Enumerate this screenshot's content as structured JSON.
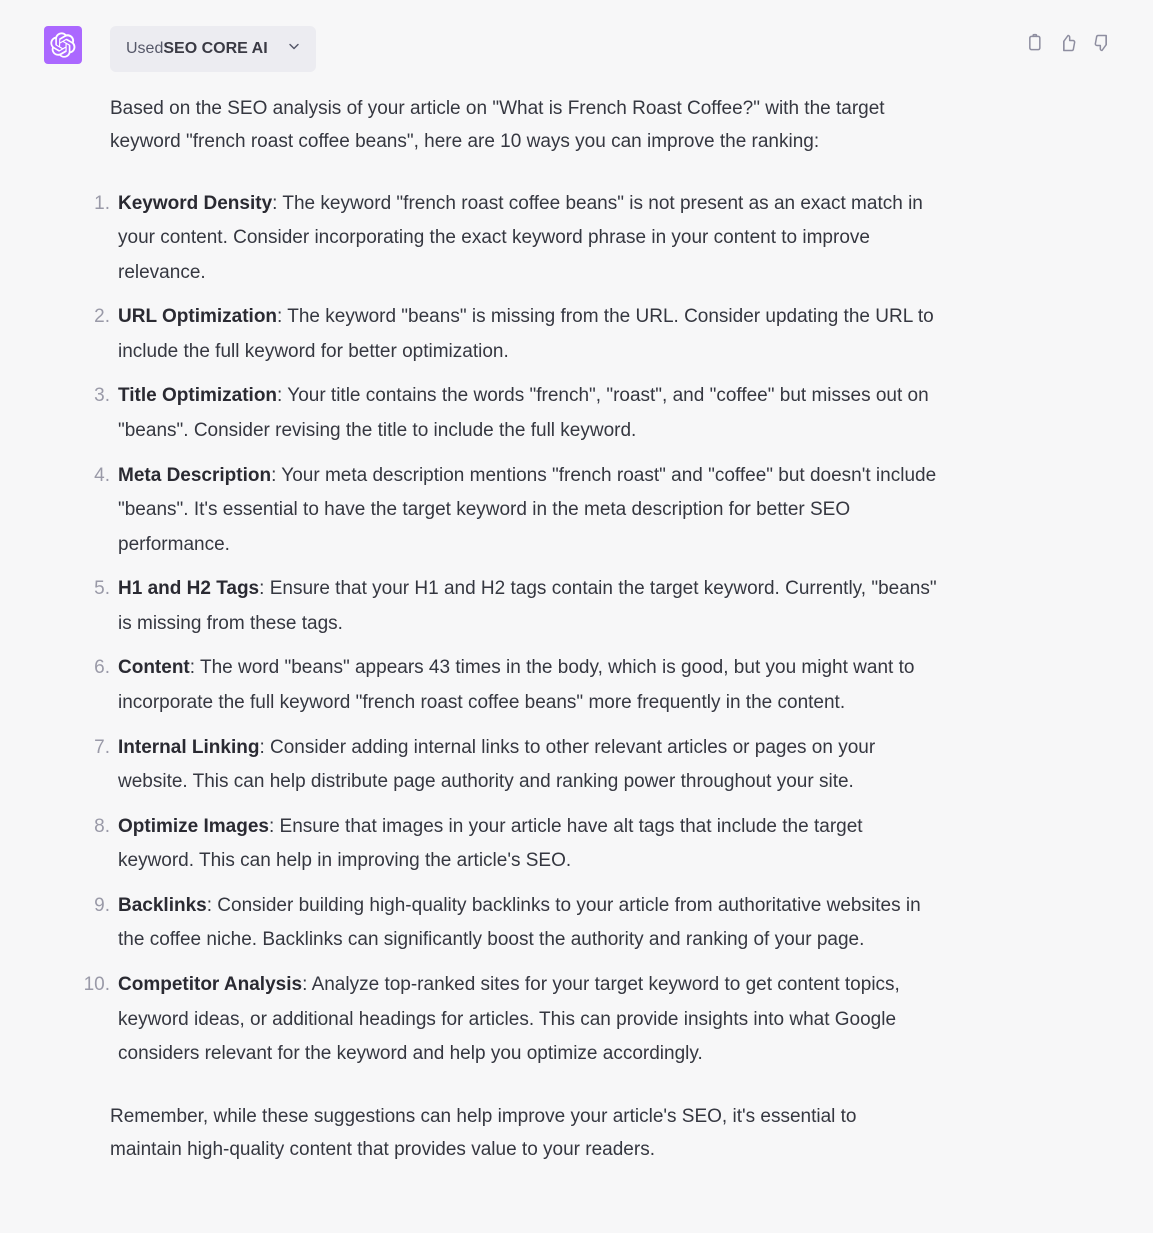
{
  "plugin": {
    "used_label": "Used ",
    "name": "SEO CORE AI"
  },
  "intro": "Based on the SEO analysis of your article on \"What is French Roast Coffee?\" with the target keyword \"french roast coffee beans\", here are 10 ways you can improve the ranking:",
  "items": [
    {
      "title": "Keyword Density",
      "body": ": The keyword \"french roast coffee beans\" is not present as an exact match in your content. Consider incorporating the exact keyword phrase in your content to improve relevance."
    },
    {
      "title": "URL Optimization",
      "body": ": The keyword \"beans\" is missing from the URL. Consider updating the URL to include the full keyword for better optimization."
    },
    {
      "title": "Title Optimization",
      "body": ": Your title contains the words \"french\", \"roast\", and \"coffee\" but misses out on \"beans\". Consider revising the title to include the full keyword."
    },
    {
      "title": "Meta Description",
      "body": ": Your meta description mentions \"french roast\" and \"coffee\" but doesn't include \"beans\". It's essential to have the target keyword in the meta description for better SEO performance."
    },
    {
      "title": "H1 and H2 Tags",
      "body": ": Ensure that your H1 and H2 tags contain the target keyword. Currently, \"beans\" is missing from these tags."
    },
    {
      "title": "Content",
      "body": ": The word \"beans\" appears 43 times in the body, which is good, but you might want to incorporate the full keyword \"french roast coffee beans\" more frequently in the content."
    },
    {
      "title": "Internal Linking",
      "body": ": Consider adding internal links to other relevant articles or pages on your website. This can help distribute page authority and ranking power throughout your site."
    },
    {
      "title": "Optimize Images",
      "body": ": Ensure that images in your article have alt tags that include the target keyword. This can help in improving the article's SEO."
    },
    {
      "title": "Backlinks",
      "body": ": Consider building high-quality backlinks to your article from authoritative websites in the coffee niche. Backlinks can significantly boost the authority and ranking of your page."
    },
    {
      "title": "Competitor Analysis",
      "body": ": Analyze top-ranked sites for your target keyword to get content topics, keyword ideas, or additional headings for articles. This can provide insights into what Google considers relevant for the keyword and help you optimize accordingly."
    }
  ],
  "outro": "Remember, while these suggestions can help improve your article's SEO, it's essential to maintain high-quality content that provides value to your readers."
}
